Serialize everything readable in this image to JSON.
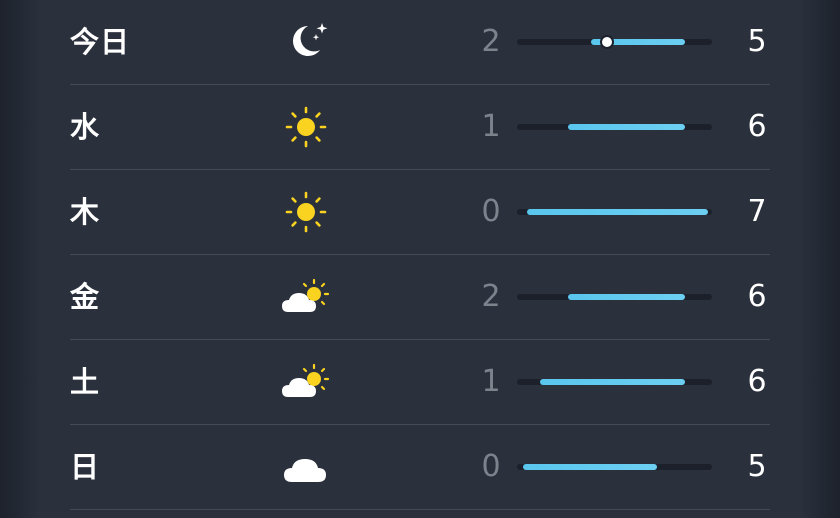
{
  "forecast": {
    "scale_min": 0,
    "scale_max": 7,
    "current_temp": 4,
    "bar_color": "#5ac6ee",
    "rows": [
      {
        "day": "今日",
        "icon": "moon-stars-icon",
        "low": "2",
        "high": "5",
        "bar_start": 0.38,
        "bar_end": 0.86
      },
      {
        "day": "水",
        "icon": "sun-icon",
        "low": "1",
        "high": "6",
        "bar_start": 0.26,
        "bar_end": 0.86
      },
      {
        "day": "木",
        "icon": "sun-icon",
        "low": "0",
        "high": "7",
        "bar_start": 0.05,
        "bar_end": 0.98
      },
      {
        "day": "金",
        "icon": "partly-cloudy-icon",
        "low": "2",
        "high": "6",
        "bar_start": 0.26,
        "bar_end": 0.86
      },
      {
        "day": "土",
        "icon": "partly-cloudy-icon",
        "low": "1",
        "high": "6",
        "bar_start": 0.12,
        "bar_end": 0.86
      },
      {
        "day": "日",
        "icon": "cloud-icon",
        "low": "0",
        "high": "5",
        "bar_start": 0.03,
        "bar_end": 0.72
      }
    ]
  }
}
